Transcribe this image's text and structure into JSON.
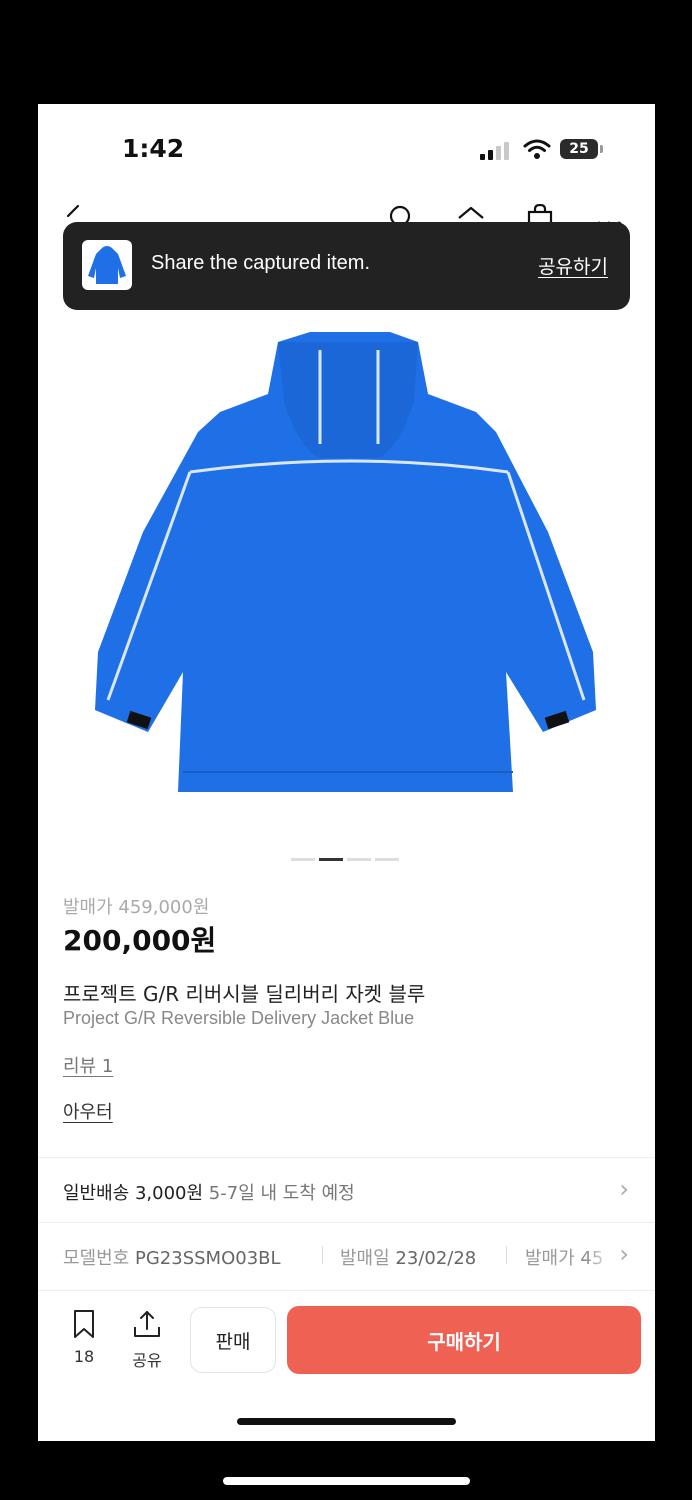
{
  "status_bar": {
    "time": "1:42",
    "battery": "25"
  },
  "toast": {
    "message": "Share the captured item.",
    "action": "공유하기"
  },
  "carousel": {
    "count": 4,
    "active_index": 1
  },
  "product": {
    "release_price": "발매가 459,000원",
    "price": "200,000원",
    "title_ko": "프로젝트 G/R 리버시블 딜리버리 자켓 블루",
    "title_en": "Project G/R Reversible Delivery Jacket Blue",
    "review_link": "리뷰 1",
    "category": "아우터",
    "color": "#1f6fe6"
  },
  "shipping": {
    "label": "일반배송 3,000원",
    "eta": "5-7일 내 도착 예정"
  },
  "info": {
    "model_label": "모델번호",
    "model_value": "PG23SSMO03BL",
    "release_date_label": "발매일",
    "release_date_value": "23/02/28",
    "release_price_label": "발매가",
    "release_price_value": "45"
  },
  "bottom_bar": {
    "bookmark_count": "18",
    "share_label": "공유",
    "sell_label": "판매",
    "buy_label": "구매하기",
    "buy_color": "#ef6253"
  }
}
